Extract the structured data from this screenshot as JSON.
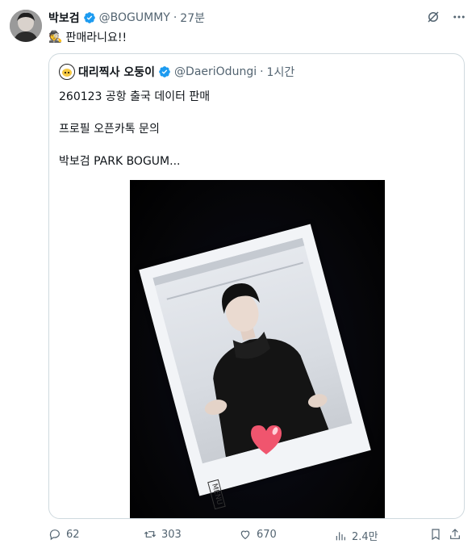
{
  "author": {
    "name": "박보검",
    "handle": "@BOGUMMY",
    "dot": "·",
    "time": "27분"
  },
  "tweet": {
    "emoji": "🕵",
    "text": "판매라니요!!"
  },
  "quote": {
    "name": "대리찍사 오둥이",
    "handle": "@DaeriOdungi",
    "dot": "·",
    "time": "1시간",
    "lines": [
      "260123 공항 출국 데이터 판매",
      "프로필 오픈카톡 문의",
      "박보검 PARK BOGUM..."
    ]
  },
  "photo": {
    "menu_label": "MENU"
  },
  "actions": {
    "replies": "62",
    "retweets": "303",
    "likes": "670",
    "views": "2.4만"
  },
  "colors": {
    "verified": "#1d9bf0",
    "muted": "#536471",
    "border": "#cfd9de",
    "heart_sticker": "#f0556e"
  },
  "icons": [
    "grok-icon",
    "more-icon",
    "verified-badge-icon",
    "reply-icon",
    "retweet-icon",
    "like-icon",
    "views-icon",
    "bookmark-icon",
    "share-icon"
  ]
}
